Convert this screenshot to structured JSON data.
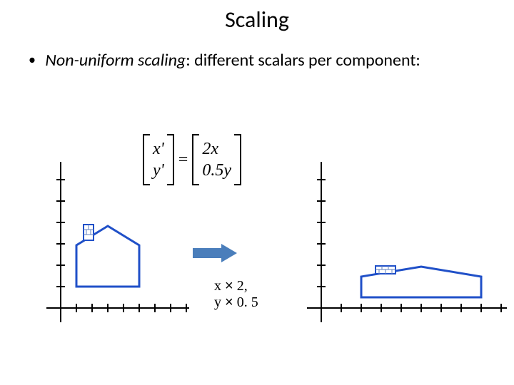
{
  "title": "Scaling",
  "bullet": {
    "term": "Non-uniform scaling",
    "rest": ": different scalars per component:"
  },
  "equation": {
    "lhs": {
      "r1": "x'",
      "r2": "y'"
    },
    "eq": "=",
    "rhs": {
      "r1": "2x",
      "r2": "0.5y"
    }
  },
  "arrow_label": {
    "line1_a": "x ",
    "line1_b": " 2,",
    "line2_a": "y ",
    "line2_b": " 0. 5",
    "times": "×"
  },
  "chart_data": {
    "type": "diagram",
    "title": "Non-uniform scaling of a 2D house shape",
    "before": {
      "axis_range_shown": {
        "x": [
          0,
          8
        ],
        "y": [
          0,
          7
        ]
      },
      "house_body": {
        "x": 1,
        "y": 1,
        "w": 3,
        "h": 2
      },
      "roof_peak_y": 4.2,
      "chimney": {
        "x": 1.4,
        "y": 3.4,
        "w": 0.5,
        "h": 0.8
      }
    },
    "after": {
      "axis_range_shown": {
        "x": [
          0,
          9
        ],
        "y": [
          0,
          7
        ]
      },
      "house_body": {
        "x": 2,
        "y": 0.5,
        "w": 6,
        "h": 1
      },
      "roof_peak_y": 2.1,
      "chimney": {
        "x": 2.8,
        "y": 1.7,
        "w": 1.0,
        "h": 0.4
      }
    },
    "transform": {
      "sx": 2,
      "sy": 0.5
    }
  }
}
